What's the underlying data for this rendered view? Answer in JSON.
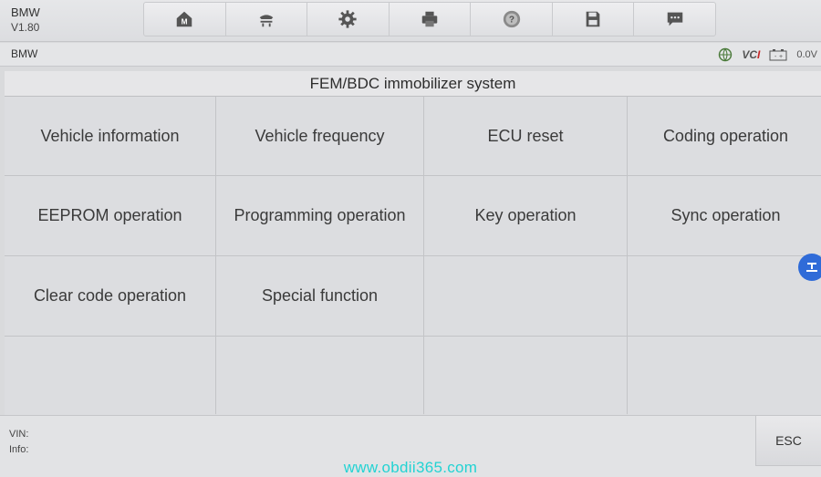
{
  "header": {
    "make": "BMW",
    "version": "V1.80",
    "toolbar": [
      {
        "icon": "home-icon"
      },
      {
        "icon": "vehicle-lift-icon"
      },
      {
        "icon": "gear-icon"
      },
      {
        "icon": "printer-icon"
      },
      {
        "icon": "help-icon"
      },
      {
        "icon": "save-icon"
      },
      {
        "icon": "message-icon"
      }
    ]
  },
  "status": {
    "make": "BMW",
    "vci_label_prefix": "VC",
    "vci_label_suffix": "I",
    "battery": "0.0V"
  },
  "title": "FEM/BDC immobilizer system",
  "menu": {
    "items": [
      "Vehicle information",
      "Vehicle frequency",
      "ECU reset",
      "Coding operation",
      "EEPROM operation",
      "Programming operation",
      "Key operation",
      "Sync operation",
      "Clear code operation",
      "Special function"
    ]
  },
  "footer": {
    "vin_label": "VIN:",
    "info_label": "Info:",
    "esc_label": "ESC"
  },
  "watermark": "www.obdii365.com",
  "colors": {
    "accent": "#2f6bd8",
    "watermark": "#22d3d3",
    "vci_red": "#c62828"
  }
}
